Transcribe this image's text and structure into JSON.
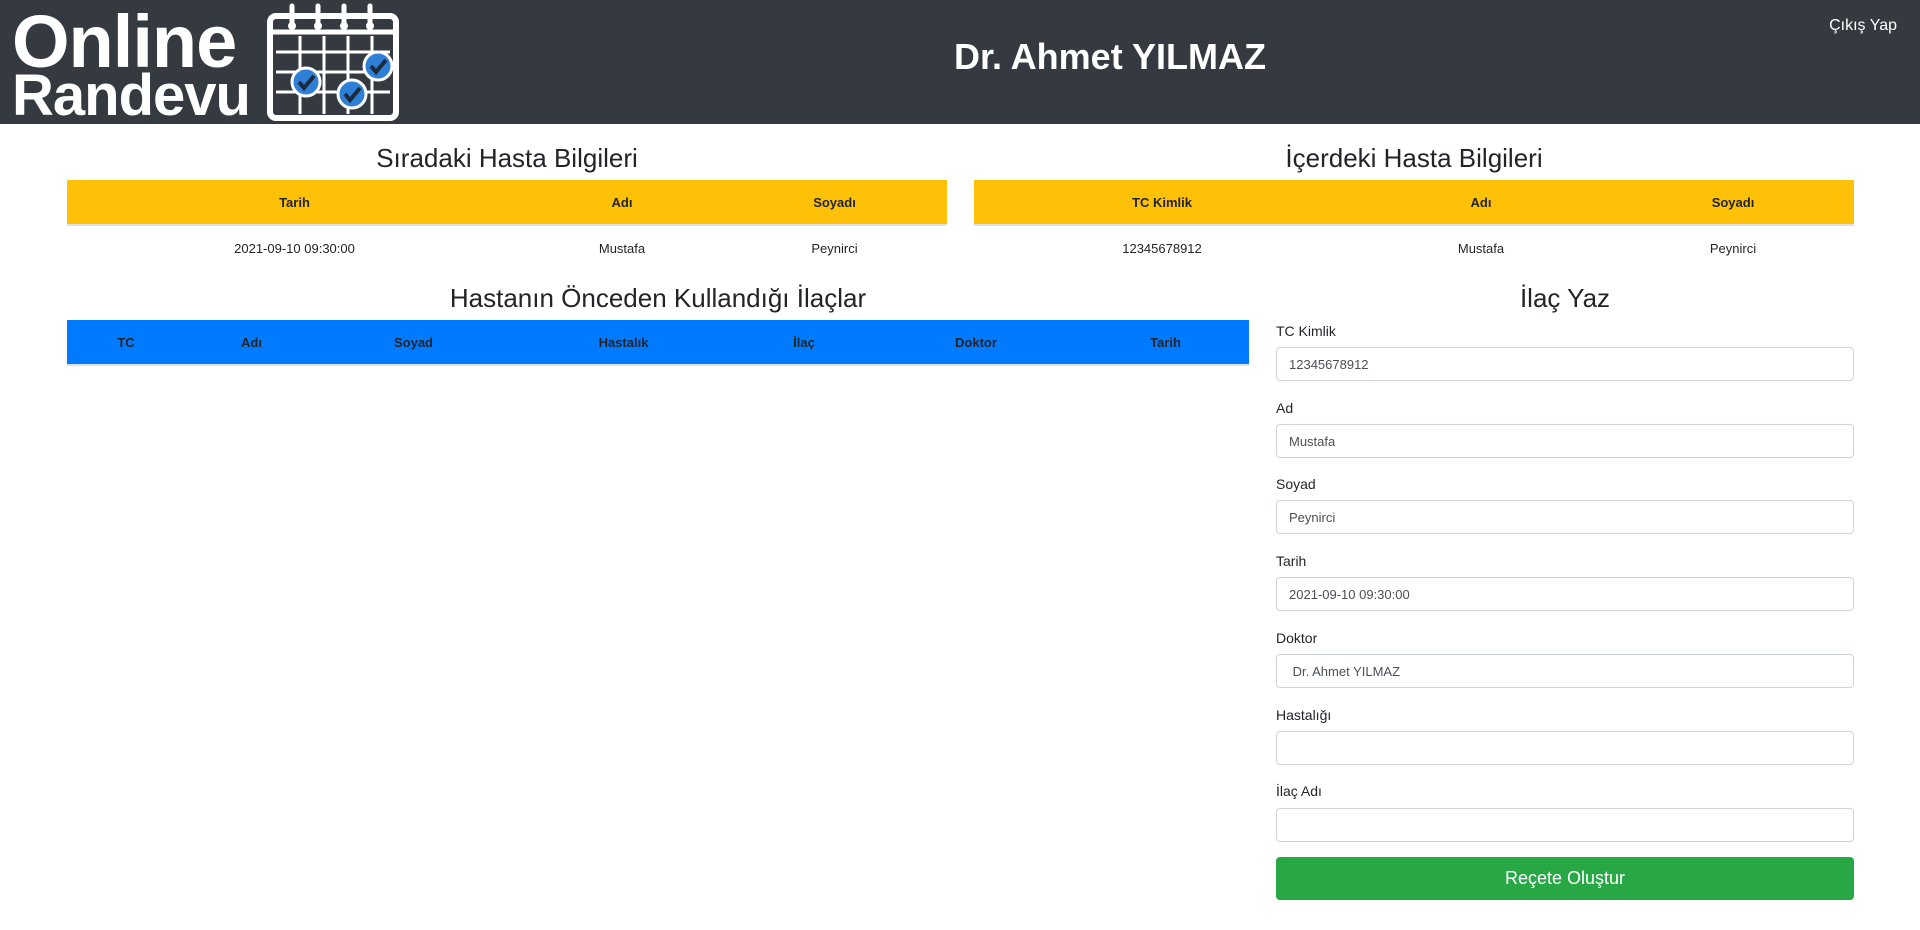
{
  "header": {
    "logo_line1": "Online",
    "logo_line2": "Randevu",
    "doctor_name": "Dr. Ahmet YILMAZ",
    "logout_label": "Çıkış Yap"
  },
  "next_patient": {
    "title": "Sıradaki Hasta Bilgileri",
    "columns": [
      "Tarih",
      "Adı",
      "Soyadı"
    ],
    "row": [
      "2021-09-10 09:30:00",
      "Mustafa",
      "Peynirci"
    ]
  },
  "current_patient": {
    "title": "İçerdeki Hasta Bilgileri",
    "columns": [
      "TC Kimlik",
      "Adı",
      "Soyadı"
    ],
    "row": [
      "12345678912",
      "Mustafa",
      "Peynirci"
    ]
  },
  "medication_history": {
    "title": "Hastanın Önceden Kullandığı İlaçlar",
    "columns": [
      "TC",
      "Adı",
      "Soyad",
      "Hastalık",
      "İlaç",
      "Doktor",
      "Tarih"
    ]
  },
  "prescription_form": {
    "title": "İlaç Yaz",
    "fields": [
      {
        "label": "TC Kimlik",
        "value": "12345678912"
      },
      {
        "label": "Ad",
        "value": "Mustafa"
      },
      {
        "label": "Soyad",
        "value": "Peynirci"
      },
      {
        "label": "Tarih",
        "value": "2021-09-10 09:30:00"
      },
      {
        "label": "Doktor",
        "value": " Dr. Ahmet YILMAZ"
      },
      {
        "label": "Hastalığı",
        "value": ""
      },
      {
        "label": "İlaç Adı",
        "value": ""
      }
    ],
    "submit_label": "Reçete Oluştur"
  },
  "colors": {
    "navbar": "#343a40",
    "yellow_header": "#ffc107",
    "blue_header": "#007bff",
    "submit": "#28a745",
    "logo_check": "#2f7fd6"
  }
}
